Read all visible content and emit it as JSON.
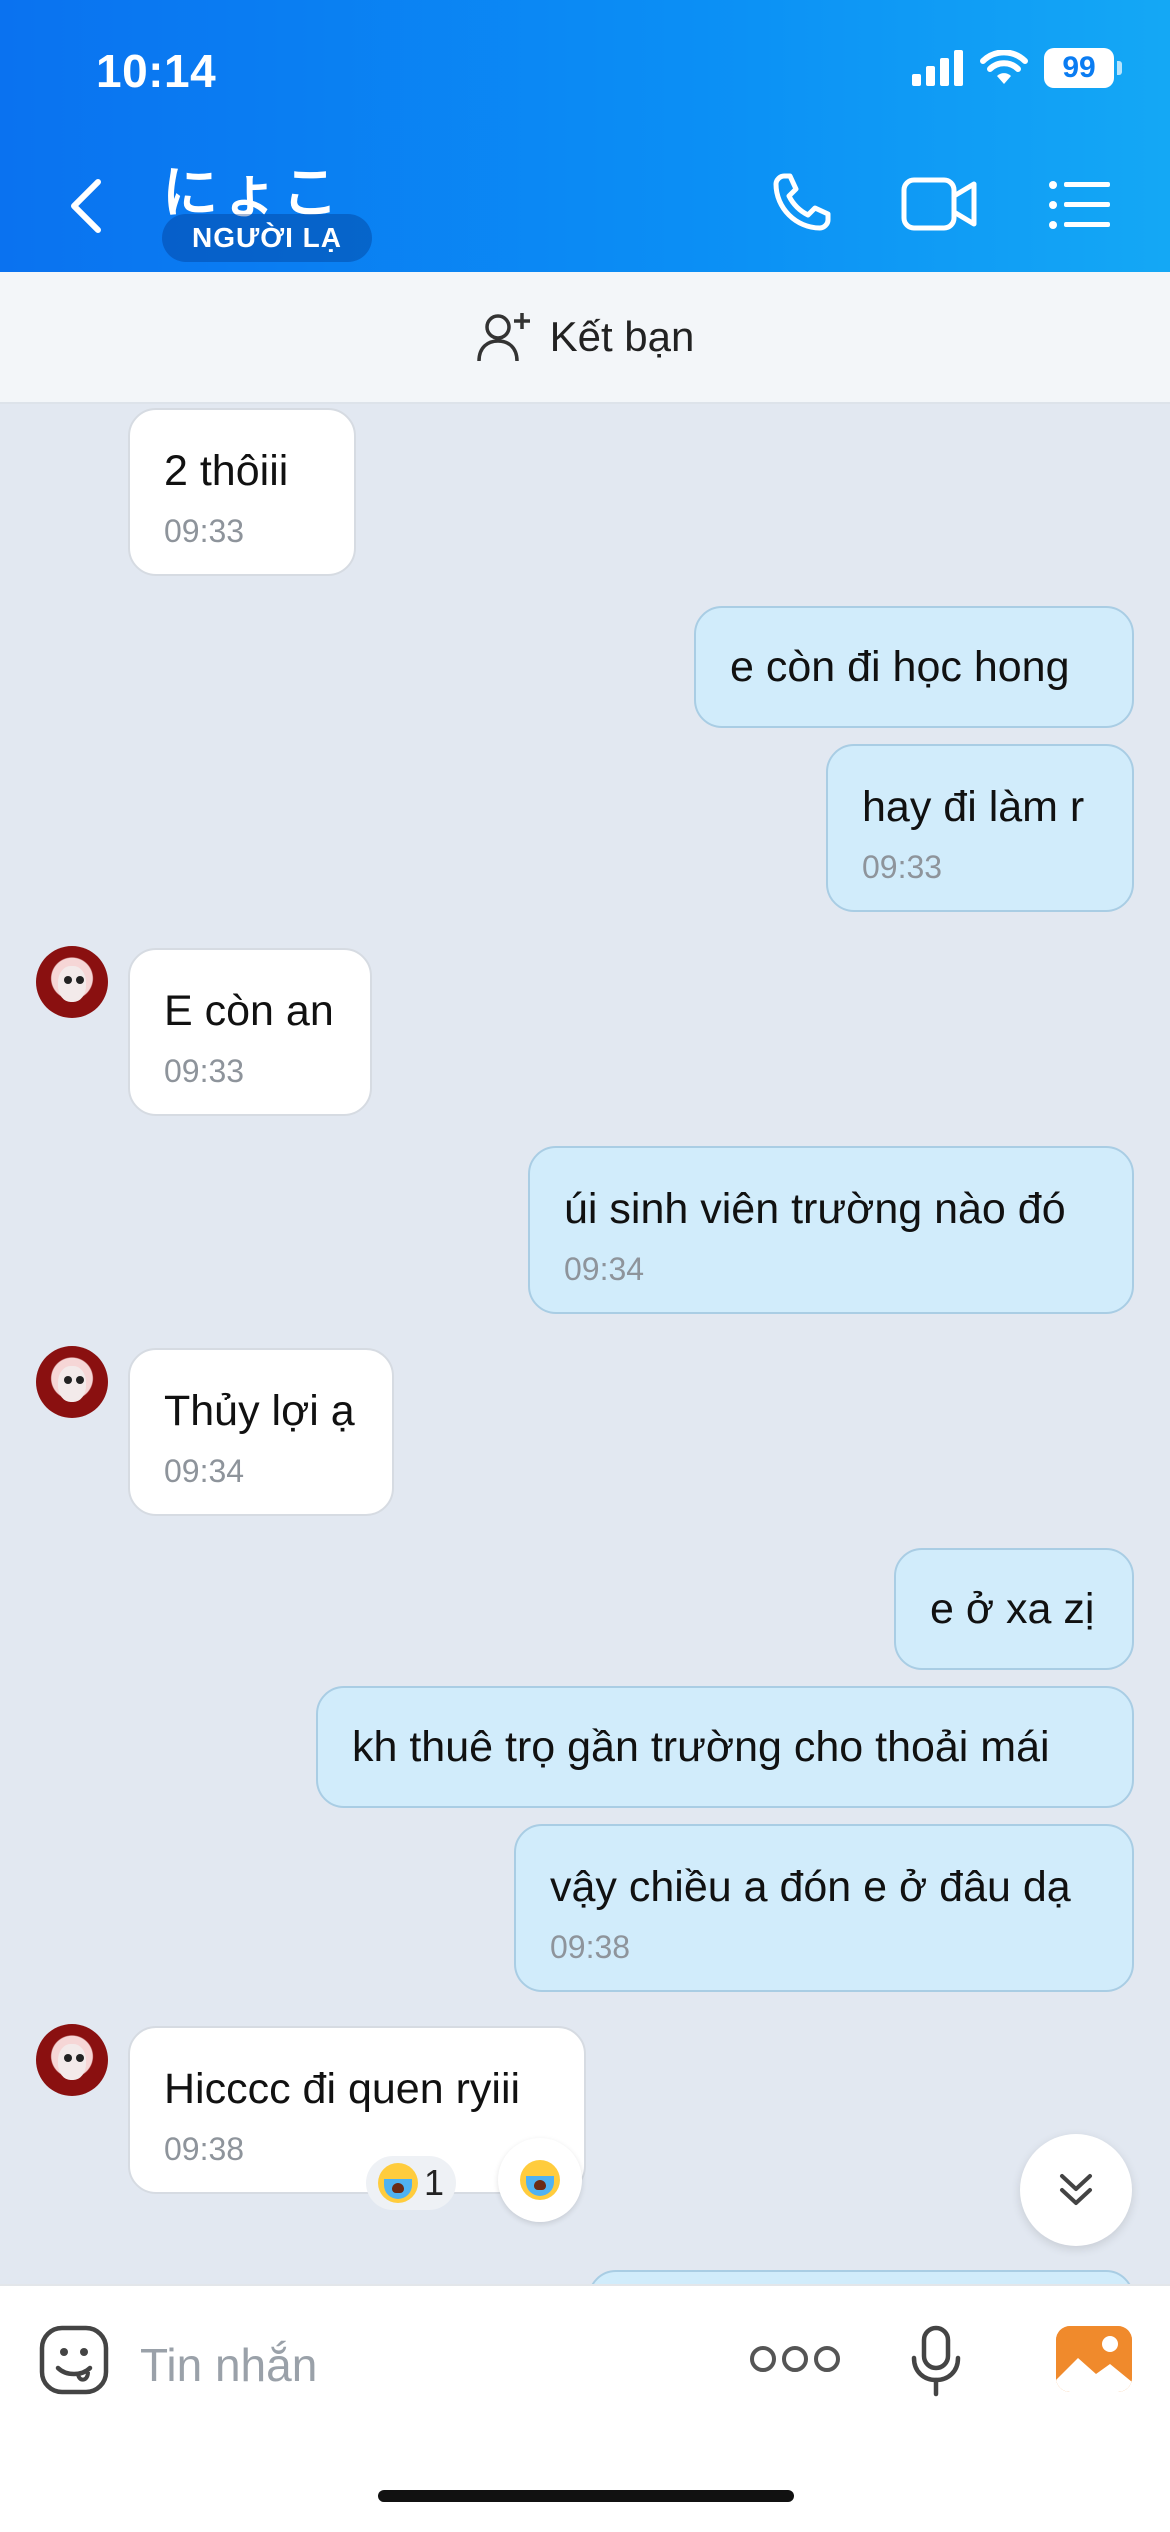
{
  "status_bar": {
    "time": "10:14",
    "battery": "99"
  },
  "header": {
    "name": "にょこ",
    "badge": "NGƯỜI LẠ"
  },
  "add_friend": {
    "label": "Kết bạn"
  },
  "messages": [
    {
      "side": "in",
      "text": "2 thôiii",
      "time": "09:33"
    },
    {
      "side": "out",
      "text": "e còn đi học hong",
      "time": ""
    },
    {
      "side": "out",
      "text": "hay đi làm r",
      "time": "09:33"
    },
    {
      "side": "in",
      "text": "E còn an",
      "time": "09:33"
    },
    {
      "side": "out",
      "text": "úi sinh viên trường nào đó",
      "time": "09:34"
    },
    {
      "side": "in",
      "text": "Thủy lợi ạ",
      "time": "09:34"
    },
    {
      "side": "out",
      "text": "e ở xa zị",
      "time": ""
    },
    {
      "side": "out",
      "text": "kh thuê trọ gần trường cho thoải mái",
      "time": ""
    },
    {
      "side": "out",
      "text": "vậy chiều a đón e ở đâu dạ",
      "time": "09:38"
    },
    {
      "side": "in",
      "text": "Hicccc đi quen ryiii",
      "time": "09:38"
    }
  ],
  "reaction": {
    "count": "1"
  },
  "input": {
    "placeholder": "Tin nhắn"
  }
}
